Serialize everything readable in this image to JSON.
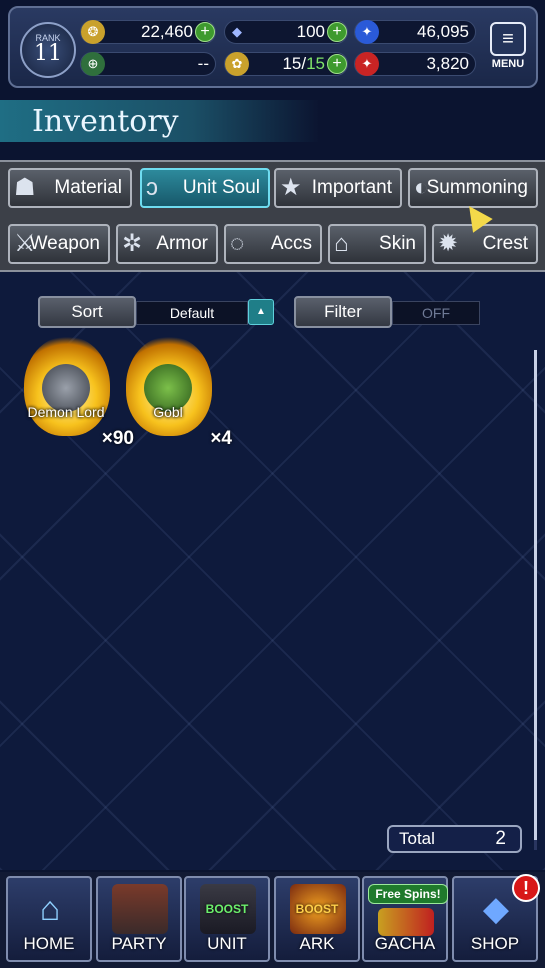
{
  "header": {
    "rank_label": "RANK",
    "rank_value": "11",
    "gold": "22,460",
    "crystals": "100",
    "blue_orbs": "46,095",
    "stamina_slot": "--",
    "stamina": "15/",
    "stamina_max": "15",
    "red_orbs": "3,820",
    "menu_label": "MENU",
    "alert_glyph": "!"
  },
  "page_title": "Inventory",
  "tabs": {
    "row1": [
      "Material",
      "Unit Soul",
      "Important",
      "Summoning"
    ],
    "row2": [
      "Weapon",
      "Armor",
      "Accs",
      "Skin",
      "Crest"
    ],
    "active": "Unit Soul"
  },
  "controls": {
    "sort_label": "Sort",
    "sort_value": "Default",
    "filter_label": "Filter",
    "filter_value": "OFF"
  },
  "items": [
    {
      "name": "Demon Lord",
      "qty": "×90"
    },
    {
      "name": "Gobl",
      "qty": "×4"
    }
  ],
  "total": {
    "label": "Total",
    "value": "2"
  },
  "nav": {
    "home": "HOME",
    "party": "PARTY",
    "unit": "UNIT",
    "unit_badge": "BOOST",
    "ark": "ARK",
    "ark_badge": "BOOST",
    "gacha": "GACHA",
    "gacha_badge": "Free Spins!",
    "shop": "SHOP",
    "shop_alert": "!"
  },
  "colors": {
    "accent_teal": "#2d8a9c",
    "plus_green": "#3e9a2e",
    "alert_red": "#d81818",
    "flame_gold": "#f7c21d"
  }
}
